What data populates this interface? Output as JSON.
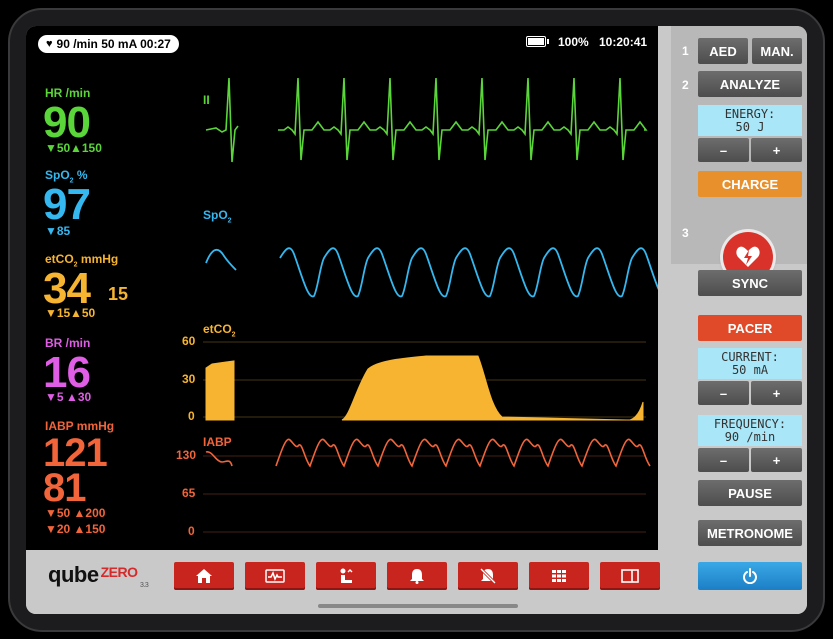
{
  "status": {
    "pacer_info": "90 /min  50 mA  00:27",
    "battery": "100%",
    "time": "10:20:41"
  },
  "vitals": {
    "hr": {
      "label": "HR /min",
      "value": "90",
      "low": "▼50",
      "high": "▲150",
      "color": "#5bd63a"
    },
    "spo2": {
      "label": "SpO",
      "label_sub": "2",
      "label_unit": " %",
      "value": "97",
      "low": "▼85",
      "color": "#35b8f0"
    },
    "etco2": {
      "label": "etCO",
      "label_sub": "2",
      "label_unit": " mmHg",
      "value": "34",
      "secondary": "15",
      "low": "▼15",
      "high": "▲50",
      "color": "#f6b431"
    },
    "br": {
      "label": "BR /min",
      "value": "16",
      "low": "▼5",
      "high": "▲30",
      "color": "#e05de6"
    },
    "iabp": {
      "label": "IABP mmHg",
      "systolic": "121",
      "diastolic": "81",
      "sys_lim": "▼50 ▲200",
      "dia_lim": "▼20 ▲150",
      "color": "#f2643a"
    }
  },
  "waves": {
    "ecg_label": "II",
    "spo2_label": "SpO",
    "spo2_label_sub": "2",
    "etco2_label": "etCO",
    "etco2_label_sub": "2",
    "etco2_scale": [
      "60",
      "30",
      "0"
    ],
    "iabp_label": "IABP",
    "iabp_scale": [
      "130",
      "65",
      "0"
    ]
  },
  "brand": {
    "name": "qube",
    "suffix": "ZERO",
    "version": "3.3"
  },
  "nav_buttons": [
    "home-icon",
    "waveform-icon",
    "patient-icon",
    "alarm-bell-icon",
    "alarm-mute-icon",
    "grid-icon",
    "layout-icon"
  ],
  "controls": {
    "step1": "1",
    "step2": "2",
    "step3": "3",
    "aed": "AED",
    "manual": "MAN.",
    "analyze": "ANALYZE",
    "energy_label": "ENERGY:",
    "energy_value": "50 J",
    "minus": "–",
    "plus": "+",
    "charge": "CHARGE",
    "sync": "SYNC",
    "pacer": "PACER",
    "current_label": "CURRENT:",
    "current_value": "50 mA",
    "frequency_label": "FREQUENCY:",
    "frequency_value": "90 /min",
    "pause": "PAUSE",
    "metronome": "METRONOME"
  },
  "colors": {
    "charge": "#e8912c",
    "pacer": "#e04a28",
    "power": "#2a94d8",
    "nav": "#c8251f"
  }
}
